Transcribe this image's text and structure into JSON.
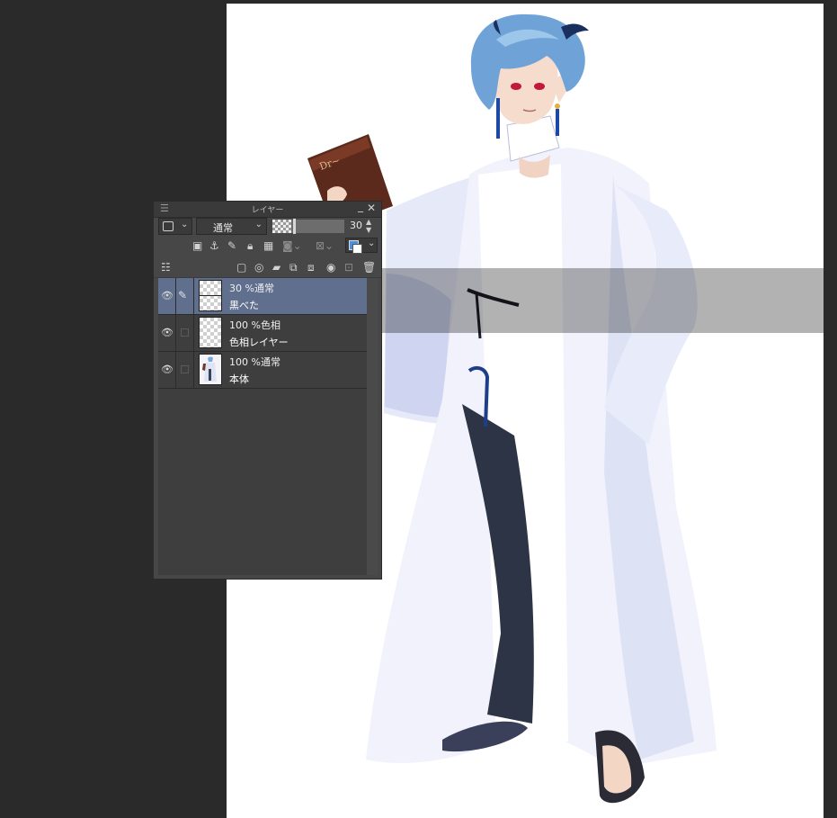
{
  "panel": {
    "title": "レイヤー",
    "menu_icon": "hamburger-menu-icon",
    "minimize_glyph": "_",
    "close_glyph": "✕",
    "blend_mode": "通常",
    "opacity_value": "30",
    "opacity_fraction": 0.3,
    "layer_color_chevron": "⌄"
  },
  "layers": [
    {
      "opacity_blend": "30 %通常",
      "name": "黒べた",
      "selected": true,
      "thumb": "checker-with-mask"
    },
    {
      "opacity_blend": "100 %色相",
      "name": "色相レイヤー",
      "selected": false,
      "thumb": "checker"
    },
    {
      "opacity_blend": "100 %通常",
      "name": "本体",
      "selected": false,
      "thumb": "character-image"
    }
  ],
  "colors": {
    "canvas_bg": "#ffffff",
    "workspace_bg": "#2a2a2a",
    "panel_bg": "#474747",
    "selected_layer": "#5f6f8d",
    "overlay_band": "#000000"
  },
  "icons": {
    "row2": [
      "clip-to-layer-below-icon",
      "reference-layer-icon",
      "draft-layer-icon",
      "lock-layer-icon",
      "lock-transparent-icon",
      "mask-enable-icon",
      "ruler-range-icon",
      "color-swatch-icon"
    ],
    "row3": [
      "layer-property-icon",
      "new-raster-layer-icon",
      "new-vector-layer-icon",
      "new-folder-icon",
      "transfer-down-icon",
      "combine-down-icon",
      "create-mask-icon",
      "apply-mask-icon",
      "delete-layer-icon"
    ]
  }
}
